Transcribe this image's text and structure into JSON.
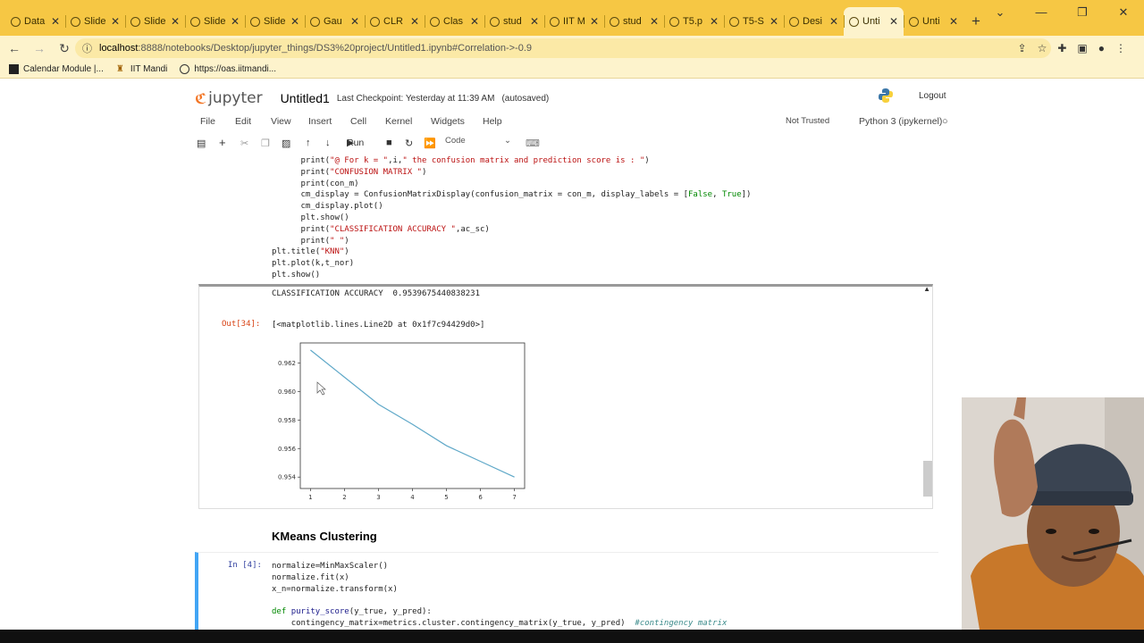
{
  "browser": {
    "tabs": [
      {
        "label": "Data"
      },
      {
        "label": "Slide"
      },
      {
        "label": "Slide"
      },
      {
        "label": "Slide"
      },
      {
        "label": "Slide"
      },
      {
        "label": "Gau"
      },
      {
        "label": "CLR"
      },
      {
        "label": "Clas"
      },
      {
        "label": "stud"
      },
      {
        "label": "IIT M"
      },
      {
        "label": "stud"
      },
      {
        "label": "T5.p"
      },
      {
        "label": "T5-S"
      },
      {
        "label": "Desi"
      },
      {
        "label": "Unti"
      },
      {
        "label": "Unti"
      }
    ],
    "active_tab_index": 14,
    "url_host": "localhost",
    "url_rest": ":8888/notebooks/Desktop/jupyter_things/DS3%20project/Untitled1.ipynb#Correlation->-0.9",
    "bookmarks": [
      {
        "label": "Calendar Module |..."
      },
      {
        "label": "IIT Mandi"
      },
      {
        "label": "https://oas.iitmandi..."
      }
    ]
  },
  "jupyter": {
    "logo_text": "jupyter",
    "notebook_name": "Untitled1",
    "checkpoint": "Last Checkpoint: Yesterday at 11:39 AM",
    "autosaved": "(autosaved)",
    "logout": "Logout",
    "menu": [
      "File",
      "Edit",
      "View",
      "Insert",
      "Cell",
      "Kernel",
      "Widgets",
      "Help"
    ],
    "trust": "Not Trusted",
    "kernel": "Python 3 (ipykernel)",
    "run_label": "Run",
    "cell_type": "Code"
  },
  "code_lines": [
    {
      "indent": "      ",
      "parts": [
        {
          "t": "print(",
          "c": ""
        },
        {
          "t": "\"@ For k = \"",
          "c": "str"
        },
        {
          "t": ",i,",
          "c": ""
        },
        {
          "t": "\" the confusion matrix and prediction score is : \"",
          "c": "str"
        },
        {
          "t": ")",
          "c": ""
        }
      ]
    },
    {
      "indent": "      ",
      "parts": [
        {
          "t": "print(",
          "c": ""
        },
        {
          "t": "\"CONFUSION MATRIX \"",
          "c": "str"
        },
        {
          "t": ")",
          "c": ""
        }
      ]
    },
    {
      "indent": "      ",
      "parts": [
        {
          "t": "print(con_m)",
          "c": ""
        }
      ]
    },
    {
      "indent": "      ",
      "parts": [
        {
          "t": "cm_display = ConfusionMatrixDisplay(confusion_matrix = con_m, display_labels = [",
          "c": ""
        },
        {
          "t": "False",
          "c": "green"
        },
        {
          "t": ", ",
          "c": ""
        },
        {
          "t": "True",
          "c": "green"
        },
        {
          "t": "])",
          "c": ""
        }
      ]
    },
    {
      "indent": "      ",
      "parts": [
        {
          "t": "cm_display.plot()",
          "c": ""
        }
      ]
    },
    {
      "indent": "      ",
      "parts": [
        {
          "t": "plt.show()",
          "c": ""
        }
      ]
    },
    {
      "indent": "      ",
      "parts": [
        {
          "t": "print(",
          "c": ""
        },
        {
          "t": "\"CLASSIFICATION ACCURACY \"",
          "c": "str"
        },
        {
          "t": ",ac_sc)",
          "c": ""
        }
      ]
    },
    {
      "indent": "      ",
      "parts": [
        {
          "t": "print(",
          "c": ""
        },
        {
          "t": "\" \"",
          "c": "str"
        },
        {
          "t": ")",
          "c": ""
        }
      ]
    },
    {
      "indent": "",
      "parts": [
        {
          "t": "plt.title(",
          "c": ""
        },
        {
          "t": "\"KNN\"",
          "c": "str"
        },
        {
          "t": ")",
          "c": ""
        }
      ]
    },
    {
      "indent": "",
      "parts": [
        {
          "t": "plt.plot(k,t_nor)",
          "c": ""
        }
      ]
    },
    {
      "indent": "",
      "parts": [
        {
          "t": "plt.show()",
          "c": ""
        }
      ]
    }
  ],
  "output": {
    "accuracy_line": "CLASSIFICATION ACCURACY  0.9539675440838231",
    "out_prompt": "Out[34]:",
    "out_text": "[<matplotlib.lines.Line2D at 0x1f7c94429d0>]"
  },
  "chart_data": {
    "type": "line",
    "x": [
      1,
      2,
      3,
      4,
      5,
      6,
      7
    ],
    "series": [
      {
        "values": [
          0.9629,
          0.961,
          0.9591,
          0.9577,
          0.9562,
          0.9551,
          0.954
        ]
      }
    ],
    "xticks": [
      1,
      2,
      3,
      4,
      5,
      6,
      7
    ],
    "yticks": [
      "0.954",
      "0.956",
      "0.958",
      "0.960",
      "0.962"
    ],
    "xlim": [
      0.7,
      7.3
    ],
    "ylim": [
      0.9532,
      0.9634
    ],
    "color": "#5fa8c8",
    "grid": false
  },
  "section_heading": "KMeans Clustering",
  "in_cell": {
    "prompt": "In [4]:",
    "lines": [
      {
        "indent": "",
        "parts": [
          {
            "t": "normalize=MinMaxScaler()",
            "c": ""
          }
        ]
      },
      {
        "indent": "",
        "parts": [
          {
            "t": "normalize.fit(x)",
            "c": ""
          }
        ]
      },
      {
        "indent": "",
        "parts": [
          {
            "t": "x_n=normalize.transform(x)",
            "c": ""
          }
        ]
      },
      {
        "indent": "",
        "parts": [
          {
            "t": "",
            "c": ""
          }
        ]
      },
      {
        "indent": "",
        "parts": [
          {
            "t": "def ",
            "c": "green"
          },
          {
            "t": "purity_score",
            "c": "fn"
          },
          {
            "t": "(y_true, y_pred):",
            "c": ""
          }
        ]
      },
      {
        "indent": "    ",
        "parts": [
          {
            "t": "contingency_matrix=metrics.cluster.contingency_matrix(y_true, y_pred)  ",
            "c": ""
          },
          {
            "t": "#contingency matrix",
            "c": "com"
          }
        ]
      }
    ]
  }
}
